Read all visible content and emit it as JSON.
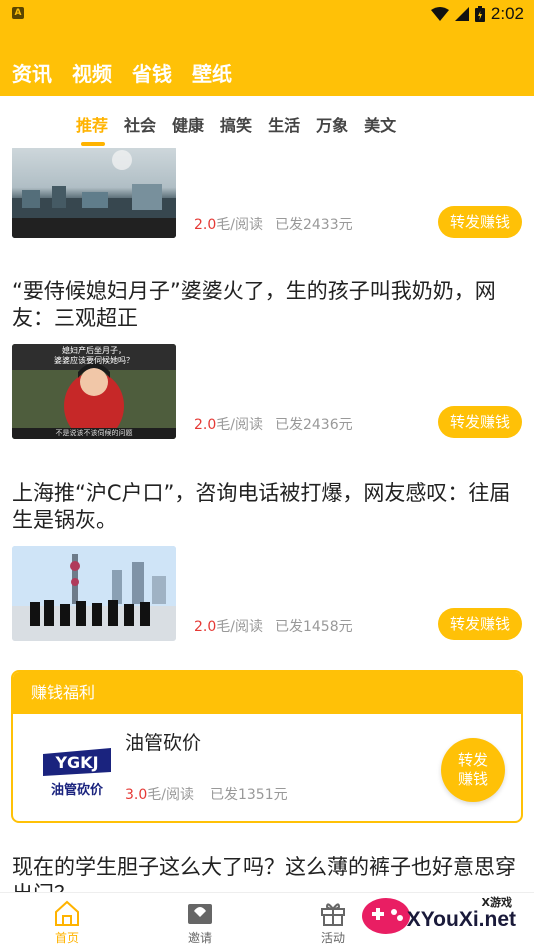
{
  "status": {
    "time": "2:02",
    "app_icon_letter": "A"
  },
  "main_tabs": [
    "资讯",
    "视频",
    "省钱",
    "壁纸"
  ],
  "category_tabs": {
    "items": [
      "推荐",
      "社会",
      "健康",
      "搞笑",
      "生活",
      "万象",
      "美文"
    ],
    "active": "推荐"
  },
  "feed": [
    {
      "title": "",
      "price": "2.0",
      "unit": "毛/阅读",
      "sent": "已发2433元",
      "button": "转发赚钱"
    },
    {
      "title": "“要侍候媳妇月子”婆婆火了，生的孩子叫我奶奶，网友：三观超正",
      "price": "2.0",
      "unit": "毛/阅读",
      "sent": "已发2436元",
      "button": "转发赚钱",
      "thumb_caption_top": "媳妇产后坐月子，",
      "thumb_caption_top2": "婆婆应该要伺候她吗？",
      "thumb_caption_bottom": "不是说该不该伺候的问题"
    },
    {
      "title": "上海推“沪C户口”，咨询电话被打爆，网友感叹：往届生是锅灰。",
      "price": "2.0",
      "unit": "毛/阅读",
      "sent": "已发1458元",
      "button": "转发赚钱"
    }
  ],
  "welfare": {
    "header": "赚钱福利",
    "title": "油管砍价",
    "logo_text_top": "YGKJ",
    "logo_text_bottom": "油管砍价",
    "price": "3.0",
    "unit": "毛/阅读",
    "sent": "已发1351元",
    "button_line1": "转发",
    "button_line2": "赚钱"
  },
  "next_title": "现在的学生胆子这么大了吗？这么薄的裤子也好意思穿出门？",
  "bottom_nav": [
    {
      "label": "首页",
      "icon": "home-icon",
      "active": true
    },
    {
      "label": "邀请",
      "icon": "invite-icon",
      "active": false
    },
    {
      "label": "活动",
      "icon": "gift-icon",
      "active": false
    }
  ],
  "watermark": {
    "small": "X游戏",
    "big": "XYouXi.net"
  },
  "colors": {
    "accent": "#FFC107",
    "price": "#E53935",
    "active_tab": "#FFB300"
  }
}
